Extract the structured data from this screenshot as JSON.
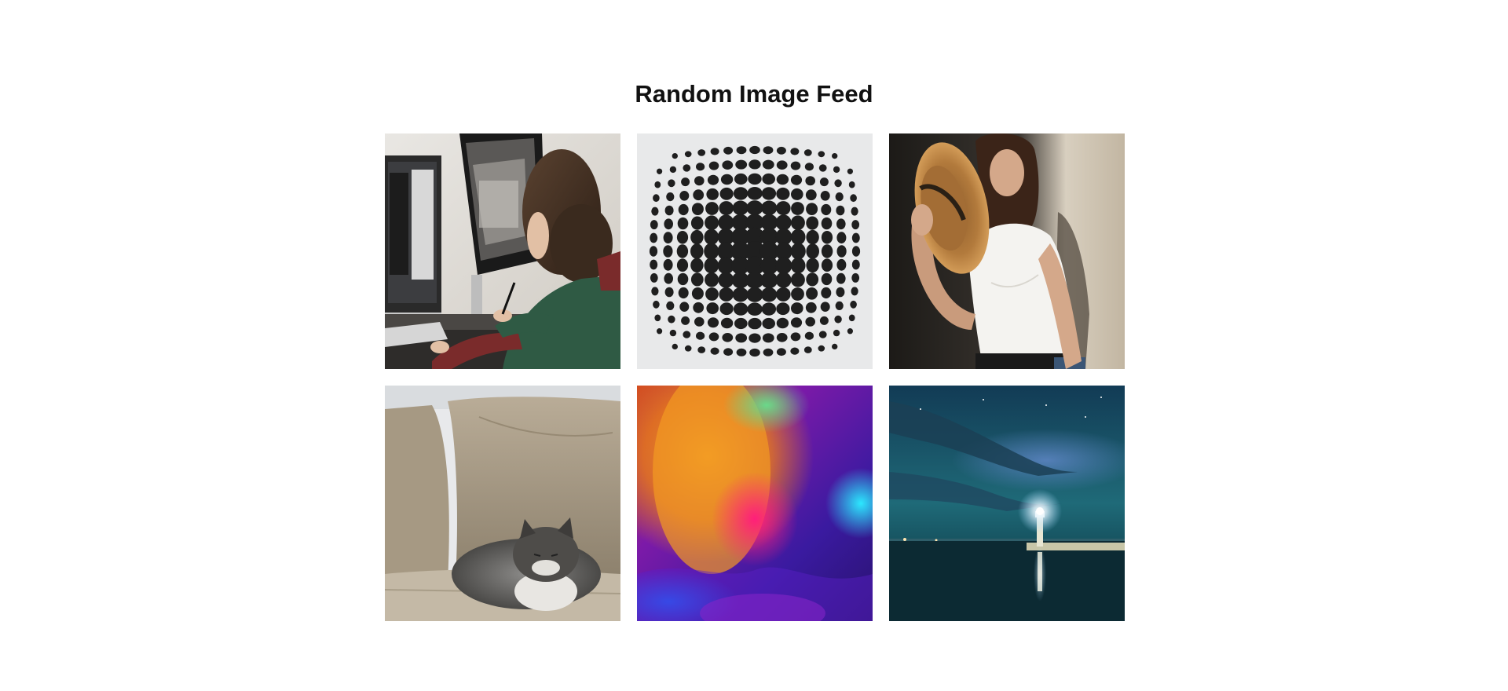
{
  "page": {
    "title": "Random Image Feed"
  },
  "feed": {
    "images": [
      {
        "subject": "woman-at-computer"
      },
      {
        "subject": "halftone-dot-sphere"
      },
      {
        "subject": "woman-with-straw-hat"
      },
      {
        "subject": "cat-on-sofa"
      },
      {
        "subject": "colorful-gradient-abstract"
      },
      {
        "subject": "lighthouse-at-night"
      }
    ]
  },
  "colors": {
    "background": "#ffffff",
    "title": "#111111"
  }
}
